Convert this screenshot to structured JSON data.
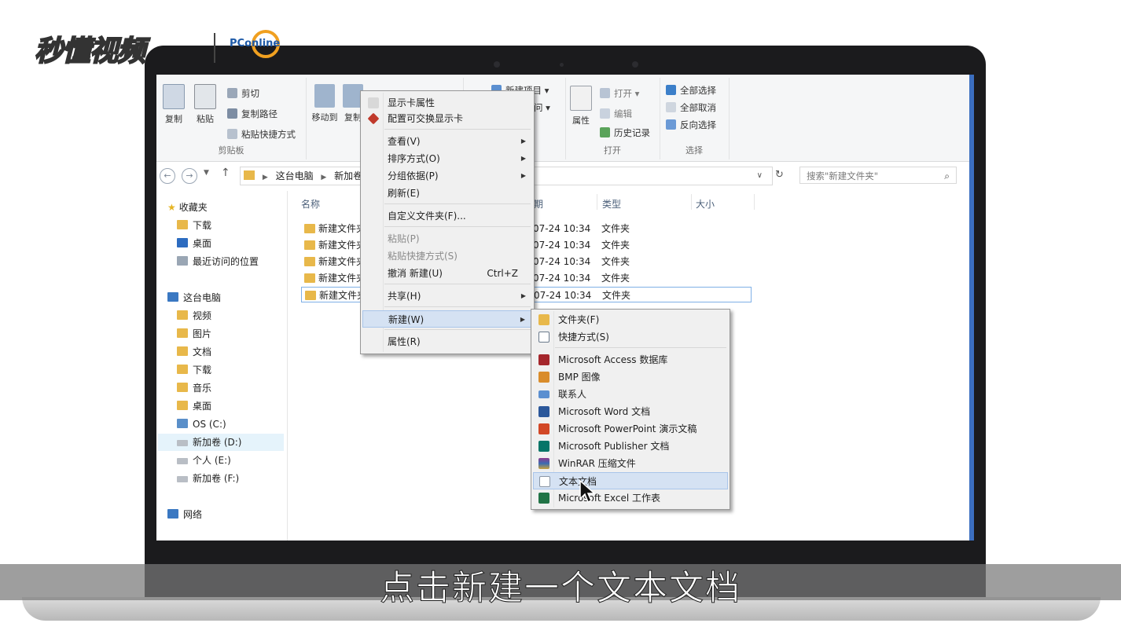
{
  "watermark": {
    "brand": "秒懂视频",
    "partner": "PConline"
  },
  "ribbon": {
    "clipboard": {
      "copy": "复制",
      "paste": "粘贴",
      "cut": "剪切",
      "copy_path": "复制路径",
      "paste_shortcut": "粘贴快捷方式",
      "group": "剪贴板"
    },
    "organize": {
      "move_to": "移动到",
      "copy_to": "复制"
    },
    "new": {
      "new_item": "新建项目",
      "easy_access": "问"
    },
    "open": {
      "properties": "属性",
      "open": "打开",
      "edit": "编辑",
      "history": "历史记录",
      "group": "打开"
    },
    "select": {
      "select_all": "全部选择",
      "select_none": "全部取消",
      "invert": "反向选择",
      "group": "选择"
    }
  },
  "nav": {
    "breadcrumb": [
      "这台电脑",
      "新加卷"
    ],
    "search_placeholder": "搜索\"新建文件夹\""
  },
  "navpane": {
    "favorites": "收藏夹",
    "fav_items": [
      "下载",
      "桌面",
      "最近访问的位置"
    ],
    "this_pc": "这台电脑",
    "pc_items": [
      "视频",
      "图片",
      "文档",
      "下载",
      "音乐",
      "桌面",
      "OS (C:)",
      "新加卷 (D:)",
      "个人 (E:)",
      "新加卷 (F:)"
    ],
    "network": "网络"
  },
  "filelist": {
    "columns": {
      "name": "名称",
      "date": "期",
      "type": "类型",
      "size": "大小"
    },
    "rows": [
      {
        "name": "新建文件夹",
        "date": "07-24 10:34",
        "type": "文件夹"
      },
      {
        "name": "新建文件夹",
        "date": "07-24 10:34",
        "type": "文件夹"
      },
      {
        "name": "新建文件夹",
        "date": "07-24 10:34",
        "type": "文件夹"
      },
      {
        "name": "新建文件夹",
        "date": "07-24 10:34",
        "type": "文件夹"
      },
      {
        "name": "新建文件夹",
        "date": "07-24 10:34",
        "type": "文件夹"
      }
    ]
  },
  "context_menu": {
    "display_props": "显示卡属性",
    "switchable_gpu": "配置可交换显示卡",
    "view": "查看(V)",
    "sort": "排序方式(O)",
    "group_by": "分组依据(P)",
    "refresh": "刷新(E)",
    "customize": "自定义文件夹(F)...",
    "paste": "粘贴(P)",
    "paste_shortcut": "粘贴快捷方式(S)",
    "undo": "撤消 新建(U)",
    "undo_key": "Ctrl+Z",
    "share": "共享(H)",
    "new": "新建(W)",
    "properties": "属性(R)"
  },
  "new_submenu": {
    "folder": "文件夹(F)",
    "shortcut": "快捷方式(S)",
    "items": [
      "Microsoft Access 数据库",
      "BMP 图像",
      "联系人",
      "Microsoft Word 文档",
      "Microsoft PowerPoint 演示文稿",
      "Microsoft Publisher 文档",
      "WinRAR 压缩文件",
      "文本文档",
      "Microsoft Excel 工作表"
    ]
  },
  "subtitle": "点击新建一个文本文档",
  "colors": {
    "accent": "#3c7fc9",
    "folder": "#e8b84a",
    "highlight": "#d5e2f3"
  }
}
